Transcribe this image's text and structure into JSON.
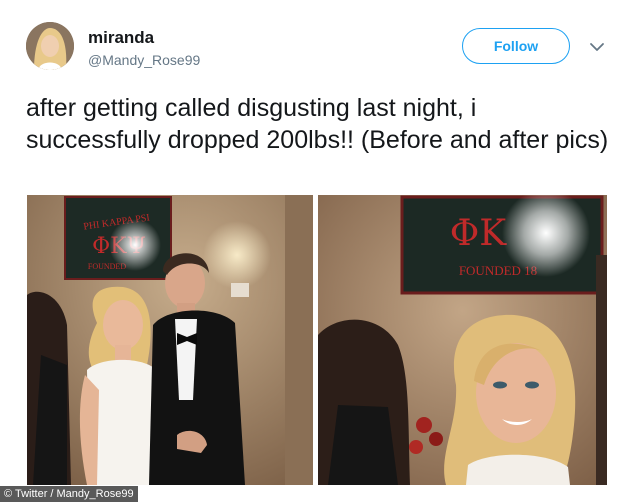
{
  "tweet": {
    "display_name": "miranda",
    "handle": "@Mandy_Rose99",
    "follow_label": "Follow",
    "text": "after getting called disgusting last night, i successfully dropped 200lbs!! (Before and after pics)"
  },
  "photos": {
    "left": {
      "sign_line1": "PHI KAPPA PSI",
      "sign_letters": "ΦΚΨ",
      "sign_line2": "FOUNDED"
    },
    "right": {
      "sign_letters": "ΦΚ",
      "sign_line2": "FOUNDED 18"
    }
  },
  "credit": "© Twitter / Mandy_Rose99",
  "icons": {
    "menu": "chevron-down-icon",
    "avatar": "avatar"
  },
  "colors": {
    "accent": "#1da1f2",
    "handle": "#657786",
    "text": "#14171a"
  }
}
